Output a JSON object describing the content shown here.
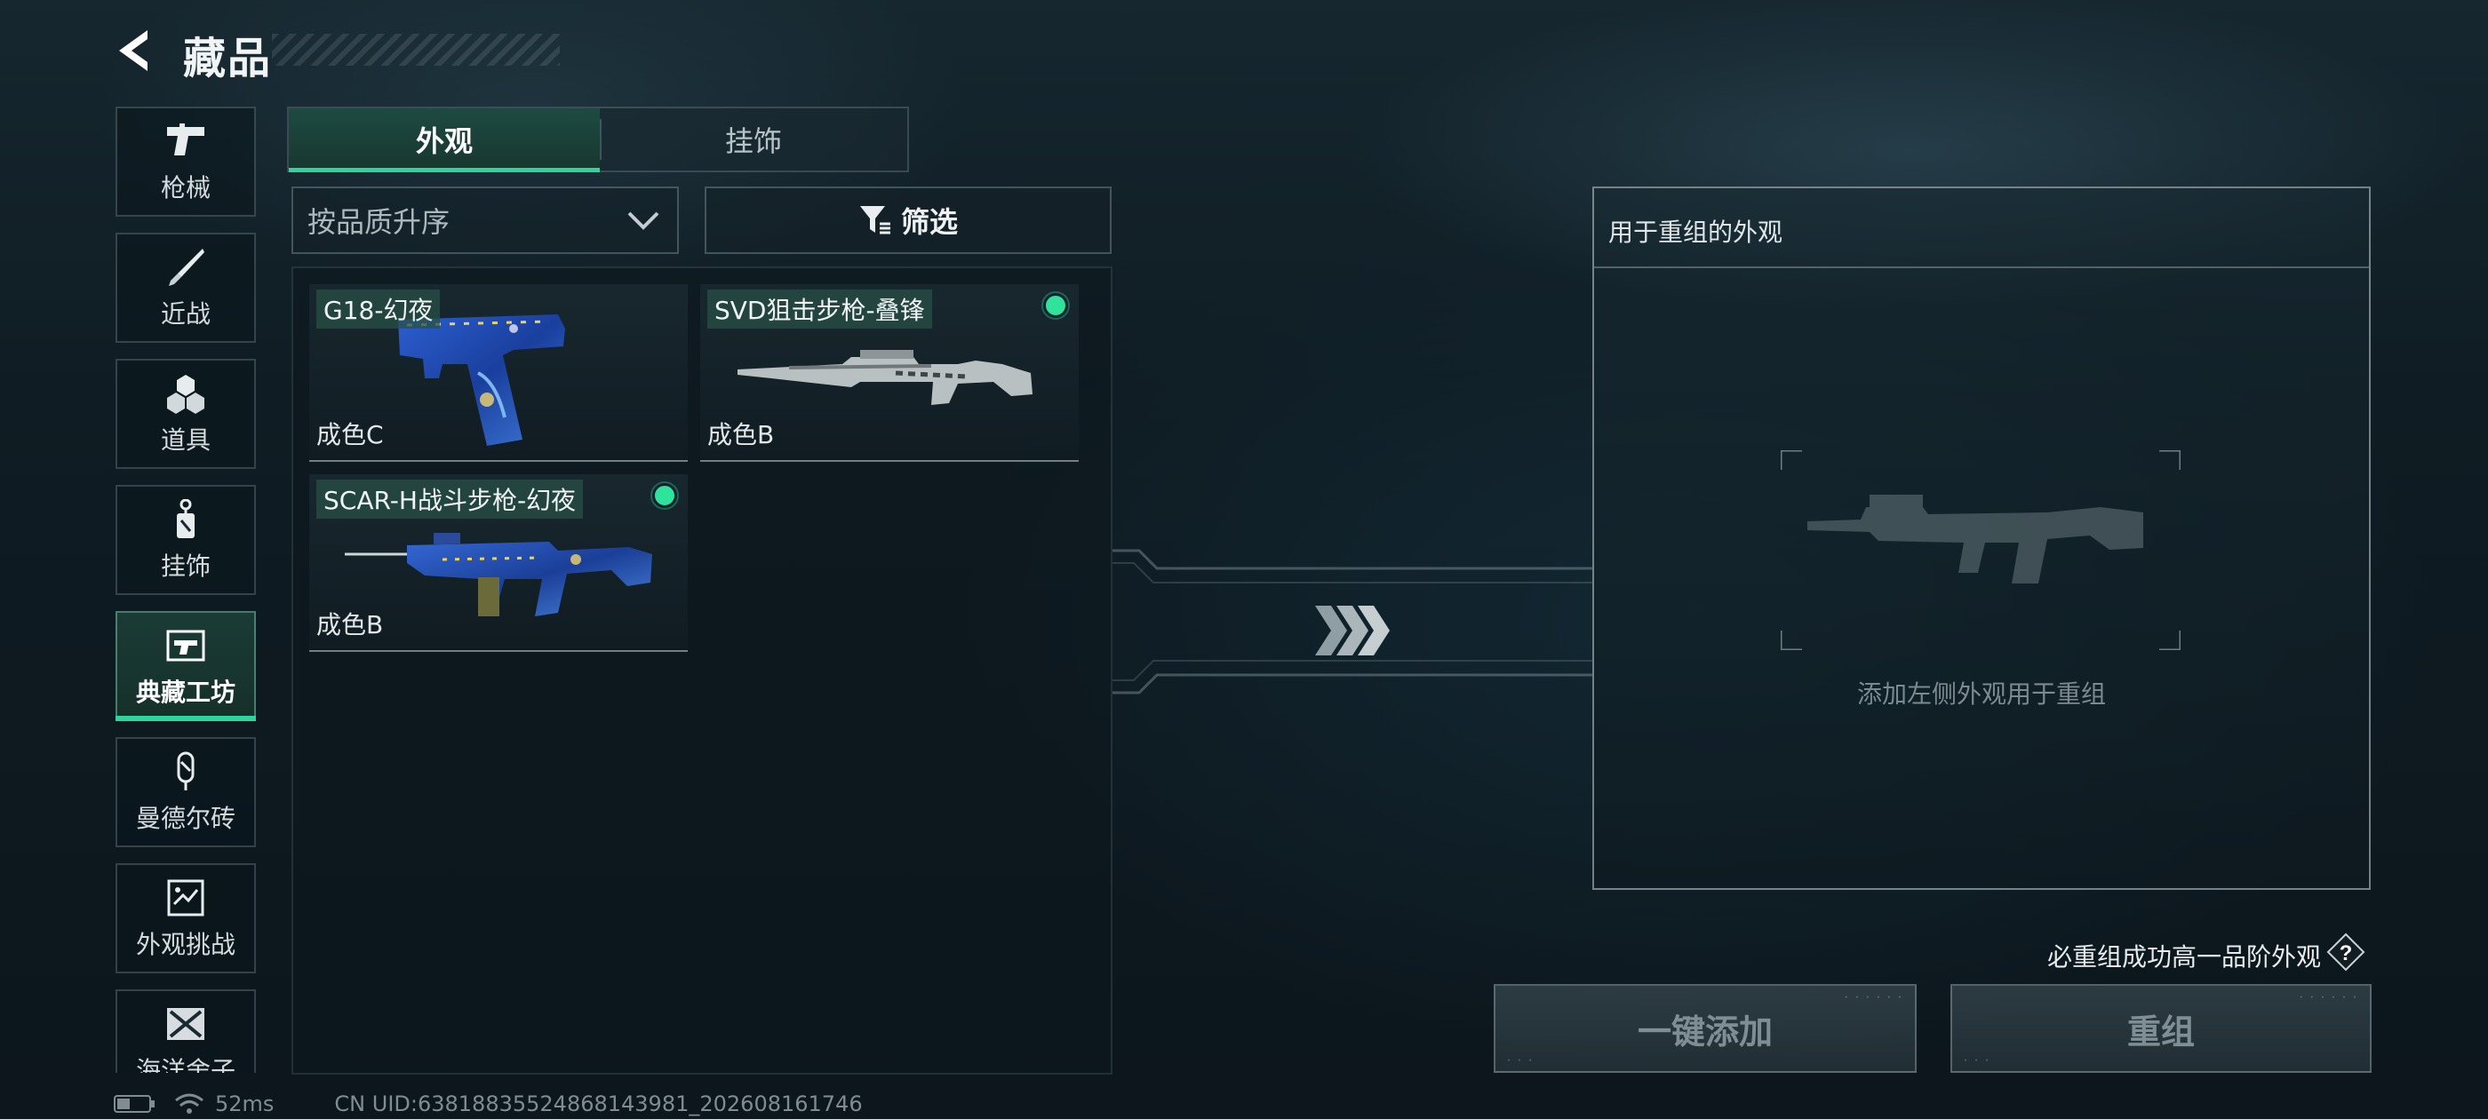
{
  "header": {
    "title": "藏品",
    "back_icon": "back-arrow-icon"
  },
  "sidebar": {
    "items": [
      {
        "label": "枪械",
        "icon": "pistol-icon",
        "active": false
      },
      {
        "label": "近战",
        "icon": "knife-icon",
        "active": false
      },
      {
        "label": "道具",
        "icon": "items-icon",
        "active": false
      },
      {
        "label": "挂饰",
        "icon": "charm-icon",
        "active": false
      },
      {
        "label": "典藏工坊",
        "icon": "workshop-icon",
        "active": true
      },
      {
        "label": "曼德尔砖",
        "icon": "mandel-brick-icon",
        "active": false
      },
      {
        "label": "外观挑战",
        "icon": "challenge-icon",
        "active": false
      },
      {
        "label": "海洋舍子",
        "icon": "crate-icon",
        "active": false
      }
    ]
  },
  "tabs": [
    {
      "label": "外观",
      "active": true
    },
    {
      "label": "挂饰",
      "active": false
    }
  ],
  "sort": {
    "selected": "按品质升序"
  },
  "filter": {
    "label": "筛选"
  },
  "items": [
    {
      "name": "G18-幻夜",
      "condition": "成色C",
      "equipped_dot": false
    },
    {
      "name": "SVD狙击步枪-叠锋",
      "condition": "成色B",
      "equipped_dot": true
    },
    {
      "name": "SCAR-H战斗步枪-幻夜",
      "condition": "成色B",
      "equipped_dot": true
    }
  ],
  "recombine_panel": {
    "title": "用于重组的外观",
    "hint": "添加左侧外观用于重组"
  },
  "guarantee": {
    "text": "必重组成功高一品阶外观",
    "help_icon": "question-icon"
  },
  "buttons": {
    "quick_add": "一键添加",
    "recombine": "重组"
  },
  "status": {
    "ping": "52ms",
    "uid": "CN UID:6381883552486814398​1_202608161746"
  },
  "colors": {
    "accent": "#2fd49b",
    "equipped_dot": "#2fe39a",
    "background": "#0f1c23"
  }
}
